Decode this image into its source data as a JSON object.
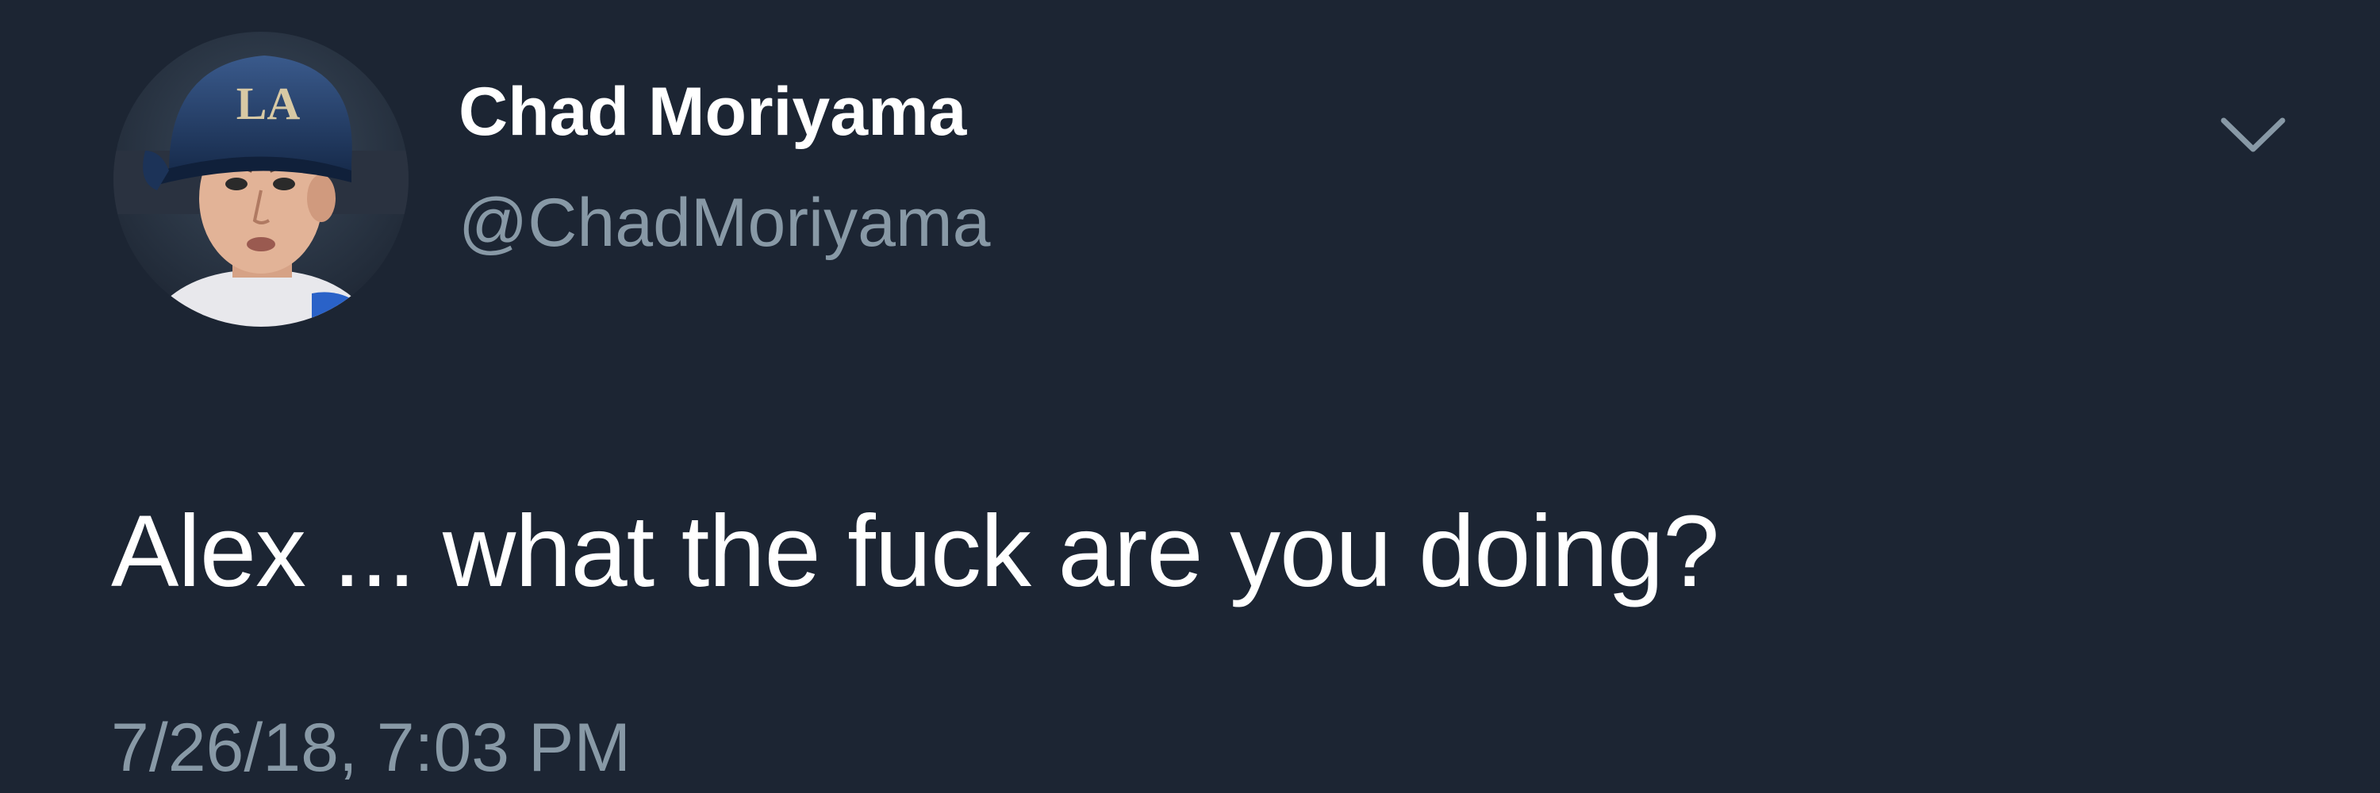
{
  "tweet": {
    "display_name": "Chad Moriyama",
    "handle": "@ChadMoriyama",
    "text": "Alex ... what the fuck are you doing?",
    "timestamp": "7/26/18, 7:03 PM",
    "avatar_icon": "user-avatar-photo",
    "menu_icon": "chevron-down-icon",
    "colors": {
      "background": "#1c2533",
      "primary_text": "#ffffff",
      "secondary_text": "#8899a6"
    }
  }
}
